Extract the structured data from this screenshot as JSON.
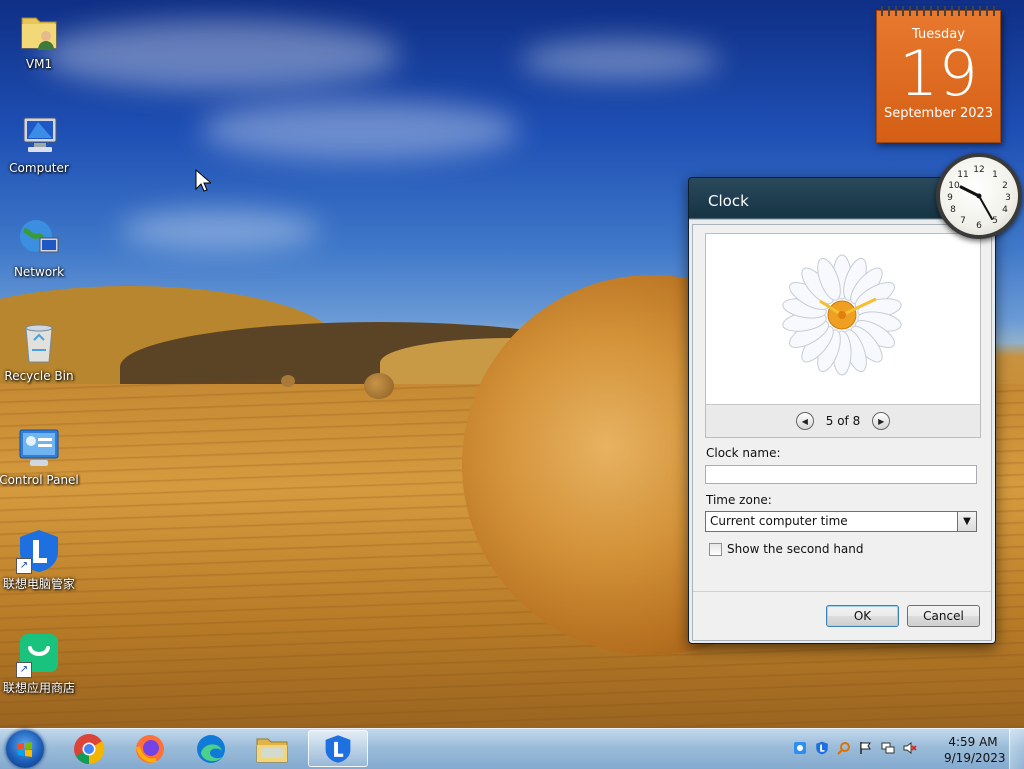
{
  "desktop": {
    "icons": [
      {
        "label": "VM1",
        "icon": "user-folder-icon"
      },
      {
        "label": "Computer",
        "icon": "computer-icon"
      },
      {
        "label": "Network",
        "icon": "network-icon"
      },
      {
        "label": "Recycle Bin",
        "icon": "recycle-bin-icon"
      },
      {
        "label": "Control Panel",
        "icon": "control-panel-icon"
      },
      {
        "label": "联想电脑管家",
        "icon": "lenovo-manager-icon"
      },
      {
        "label": "联想应用商店",
        "icon": "lenovo-store-icon"
      }
    ]
  },
  "calendar_gadget": {
    "weekday": "Tuesday",
    "day": "19",
    "month_year": "September 2023"
  },
  "dialog": {
    "title": "Clock",
    "pager": "5 of 8",
    "clock_name_label": "Clock name:",
    "clock_name_value": "",
    "time_zone_label": "Time zone:",
    "time_zone_value": "Current computer time",
    "second_hand_label": "Show the second hand",
    "second_hand_checked": false,
    "ok_label": "OK",
    "cancel_label": "Cancel"
  },
  "taskbar": {
    "apps": [
      {
        "name": "chrome-icon"
      },
      {
        "name": "firefox-icon"
      },
      {
        "name": "edge-icon"
      },
      {
        "name": "file-explorer-icon"
      },
      {
        "name": "lenovo-manager-icon",
        "active": true
      }
    ],
    "time": "4:59 AM",
    "date": "9/19/2023"
  },
  "colors": {
    "calendar_orange": "#d9651b",
    "dialog_title_bg": "#173344",
    "taskbar": "#9fbcd8"
  }
}
